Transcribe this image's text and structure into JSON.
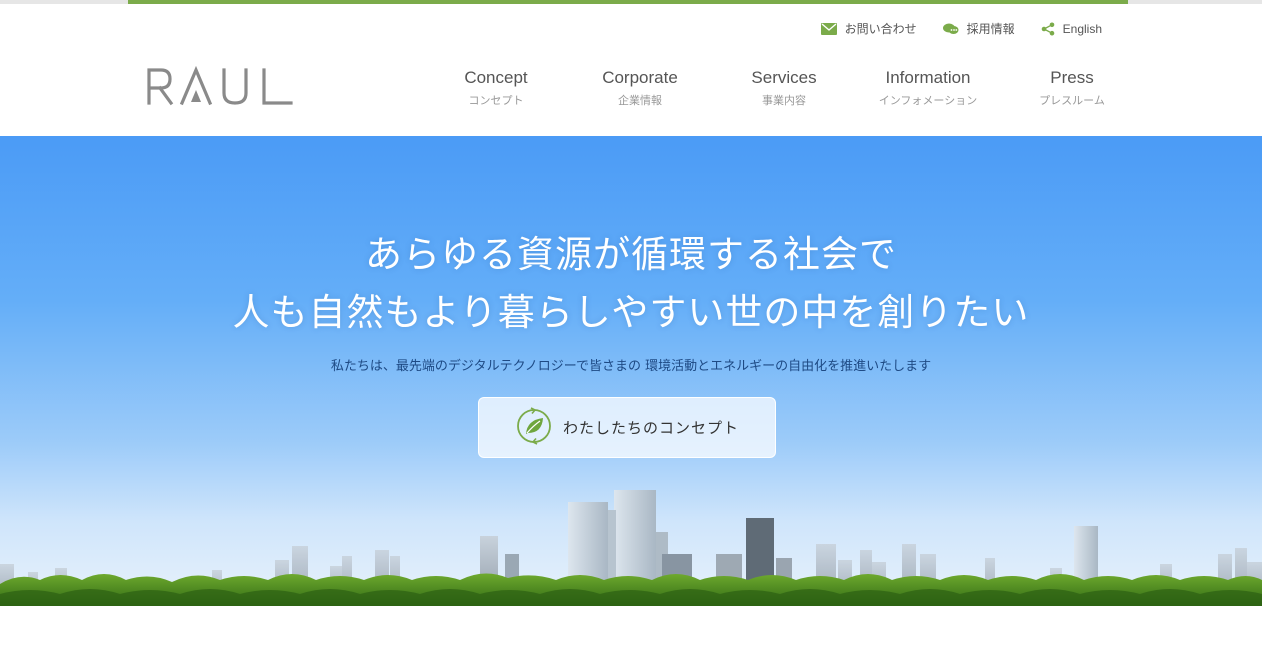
{
  "utility_links": [
    {
      "label": "お問い合わせ",
      "icon": "mail-icon"
    },
    {
      "label": "採用情報",
      "icon": "chat-icon"
    },
    {
      "label": "English",
      "icon": "share-icon"
    }
  ],
  "logo": {
    "text": "RAUL"
  },
  "nav": [
    {
      "en": "Concept",
      "jp": "コンセプト"
    },
    {
      "en": "Corporate",
      "jp": "企業情報"
    },
    {
      "en": "Services",
      "jp": "事業内容"
    },
    {
      "en": "Information",
      "jp": "インフォメーション"
    },
    {
      "en": "Press",
      "jp": "プレスルーム"
    }
  ],
  "hero": {
    "headline_line1": "あらゆる資源が循環する社会で",
    "headline_line2": "人も自然もより暮らしやすい世の中を創りたい",
    "subcopy": "私たちは、最先端のデジタルテクノロジーで皆さまの 環境活動とエネルギーの自由化を推進いたします",
    "cta_label": "わたしたちのコンセプト"
  },
  "colors": {
    "accent_green": "#7bab4a",
    "sky_top": "#4b9bf6",
    "subcopy_text": "#1e4a84"
  }
}
